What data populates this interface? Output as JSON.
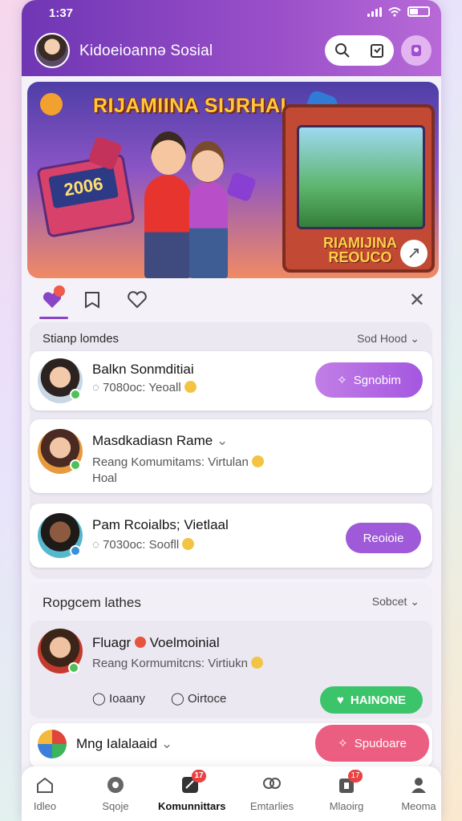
{
  "status": {
    "time": "1:37"
  },
  "header": {
    "title": "Kidoeioannə Sosial"
  },
  "banner": {
    "title": "RIJAMIINA SIJRHAL",
    "device_text": "2006",
    "arcade_label": "RIAMIJINA REOUCO"
  },
  "section1": {
    "title": "Stianp lomdes",
    "sort": "Sod Hood",
    "cards": [
      {
        "name": "Balkn Sonmditiai",
        "sub": "7080oc: Yeoall",
        "button": "Sgnobim"
      },
      {
        "name": "Masdkadiasn Rame",
        "sub": "Reang Komumitams: Virtulan",
        "sub2": "Hoal"
      },
      {
        "name": "Pam Rcoialbs; Vietlaal",
        "sub": "7030oc: Soofll",
        "button": "Reoioie"
      }
    ]
  },
  "section2": {
    "title": "Ropgcem lathes",
    "sort": "Sobcet",
    "card": {
      "name_a": "Fluagr",
      "name_b": "Voelmoinial",
      "sub": "Reang Kormumitcns: Virtiukn",
      "action1": "Ioaany",
      "action2": "Oirtoce",
      "button": "HAINONE"
    },
    "peek": {
      "name": "Mng Ialalaaid",
      "button": "Spudoare"
    }
  },
  "nav": {
    "items": [
      {
        "label": "Idleo"
      },
      {
        "label": "Sqoje"
      },
      {
        "label": "Komunnittars",
        "badge": "17"
      },
      {
        "label": "Emtarlies"
      },
      {
        "label": "Mlaoirg",
        "badge": "17"
      },
      {
        "label": "Meoma"
      }
    ]
  },
  "colors": {
    "accent": "#8a45c6",
    "green": "#3cc46a",
    "pink": "#ec5d82"
  }
}
